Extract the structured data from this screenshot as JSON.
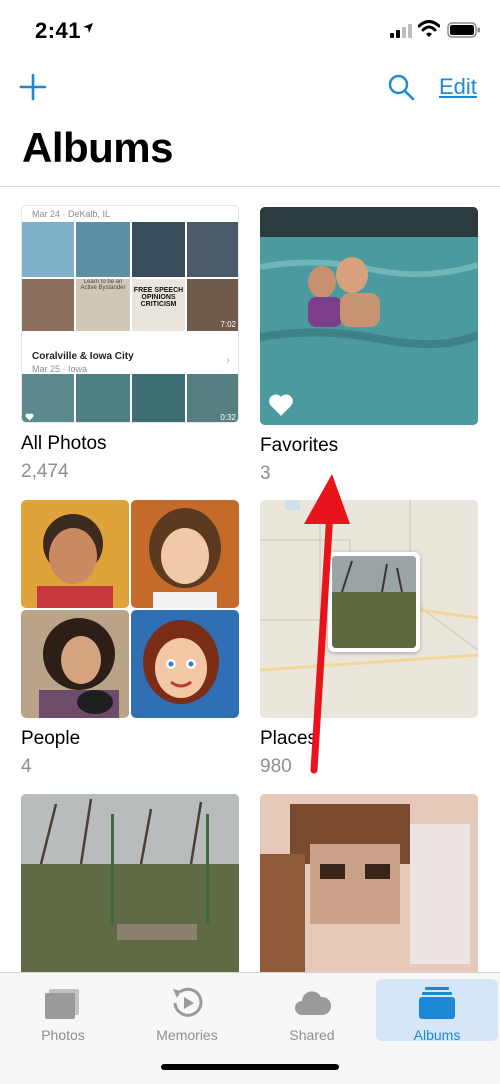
{
  "status_bar": {
    "time": "2:41"
  },
  "nav": {
    "edit_label": "Edit"
  },
  "page_title": "Albums",
  "albums": [
    {
      "name": "All Photos",
      "count": "2,474",
      "moment1_label": "Mar 24 · DeKalb, IL",
      "moment2_title": "Coralville & Iowa City",
      "moment2_label": "Mar 25 · Iowa",
      "video1_duration": "7:02",
      "video2_duration": "0:32",
      "sign_text": "FREE SPEECH OPINIONS CRITICISM",
      "sign2_text": "Learn to be an Active Bystander"
    },
    {
      "name": "Favorites",
      "count": "3"
    },
    {
      "name": "People",
      "count": "4"
    },
    {
      "name": "Places",
      "count": "980"
    },
    {
      "name": "",
      "count": ""
    },
    {
      "name": "",
      "count": ""
    }
  ],
  "tabs": [
    {
      "label": "Photos",
      "icon": "photos-icon"
    },
    {
      "label": "Memories",
      "icon": "memories-icon"
    },
    {
      "label": "Shared",
      "icon": "cloud-icon"
    },
    {
      "label": "Albums",
      "icon": "albums-icon",
      "active": true
    }
  ],
  "colors": {
    "accent": "#1d88d6",
    "annotation": "#e8131b"
  }
}
